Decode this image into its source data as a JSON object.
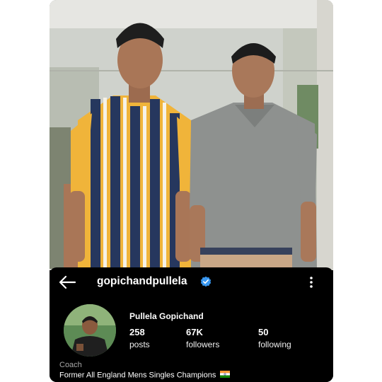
{
  "profile": {
    "username": "gopichandpullela",
    "full_name": "Pullela Gopichand",
    "verified": true,
    "category": "Coach",
    "bio": "Former All England Mens Singles Champions",
    "bio_flag_icon": "india-flag-icon"
  },
  "stats": {
    "posts": {
      "value": "258",
      "label": "posts"
    },
    "followers": {
      "value": "67K",
      "label": "followers"
    },
    "following": {
      "value": "50",
      "label": "following"
    }
  },
  "icons": {
    "back": "back-arrow-icon",
    "verified": "verified-badge-icon",
    "more": "more-options-icon"
  },
  "colors": {
    "panel_background": "#000000",
    "verified_blue": "#3897f0",
    "secondary_text": "#a8a8a8"
  }
}
